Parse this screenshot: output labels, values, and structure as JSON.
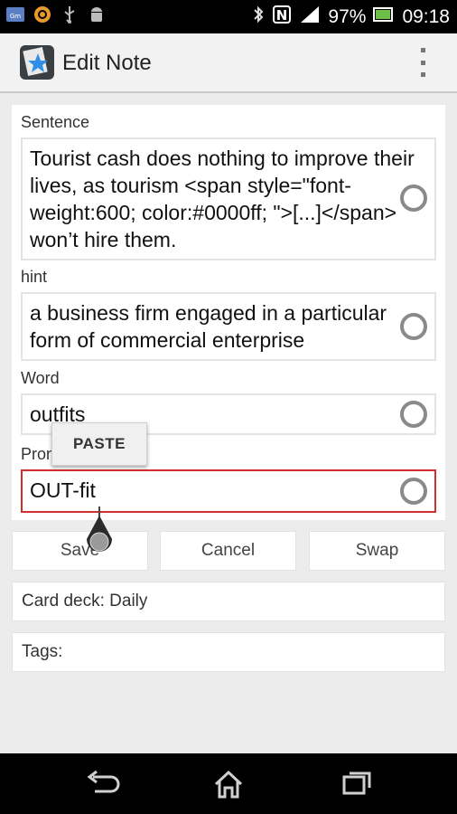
{
  "status_bar": {
    "battery": "97%",
    "time": "09:18",
    "icons": [
      "gmail-icon",
      "loading-icon",
      "usb-icon",
      "android-icon",
      "bluetooth-icon",
      "nfc-icon",
      "signal-icon",
      "battery-icon"
    ]
  },
  "action_bar": {
    "title": "Edit Note",
    "app_icon": "star-deck-icon",
    "overflow_icon": "more-vert-icon"
  },
  "fields": {
    "sentence": {
      "label": "Sentence",
      "value": "Tourist cash does nothing to improve their lives, as tourism <span style=\"font-weight:600; color:#0000ff; \">[...]</span> won’t hire them."
    },
    "hint": {
      "label": "hint",
      "value": "a business firm engaged in a particular form of commercial enterprise"
    },
    "word": {
      "label": "Word",
      "value": "outfits"
    },
    "pronunciation": {
      "label": "Pron",
      "value": "OUT-fit"
    }
  },
  "popup": {
    "paste_label": "PASTE"
  },
  "buttons": {
    "save": "Save",
    "cancel": "Cancel",
    "swap": "Swap"
  },
  "card_deck": "Card deck: Daily",
  "tags": "Tags:",
  "colors": {
    "active_border": "#d32f2f",
    "background": "#ececec"
  }
}
